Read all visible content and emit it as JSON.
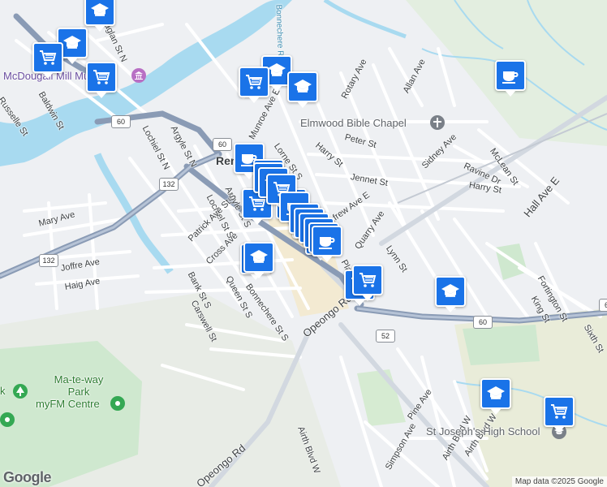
{
  "map": {
    "town_label": "Ren",
    "streets": [
      "Raglan St N",
      "Baldwin St",
      "Russelle St",
      "Lochiel St N",
      "Argyle St N",
      "Lochiel St S",
      "Argyle St S",
      "Patrick Ave St S",
      "Cross Ave",
      "Queen St S",
      "Bank St S",
      "Carswell St",
      "Mary Ave",
      "Joffre Ave",
      "Haig Ave",
      "Munroe Ave E",
      "Lorne St S",
      "Harry St",
      "Peter St",
      "Jennet St",
      "Harry St",
      "Rotary Ave",
      "Allan Ave",
      "Sidney Ave",
      "Ravine Dr",
      "McLean St",
      "Hall Ave E",
      "Quarry Ave",
      "Lynn St",
      "Fortington St",
      "King St",
      "Sixth St",
      "Opeongo Rd",
      "Renfrew Ave E",
      "Airth Blvd W",
      "Airth Blvd W",
      "Pine Ave",
      "Simpson Ave",
      "Opeongo Rd",
      "Airth Blvd W",
      "Plaunt St S",
      "Bonnechere St S",
      "Bonnechere River"
    ],
    "route_shields": [
      "60",
      "60",
      "132",
      "132",
      "60",
      "52",
      "60"
    ],
    "pois": {
      "museum": "McDougall Mill Museum",
      "chapel": "Elmwood Bible Chapel",
      "park": "Ma-te-way Park",
      "centre": "myFM Centre",
      "school": "St Joseph's High School",
      "park_edge": "k"
    },
    "markers": [
      "school-marker",
      "school-marker",
      "grocery-marker",
      "grocery-marker",
      "school-marker",
      "grocery-marker",
      "school-marker",
      "cafe-marker",
      "cafe-marker",
      "grocery-marker",
      "school-marker",
      "cafe-marker",
      "school-marker",
      "grocery-marker",
      "school-marker",
      "school-marker",
      "grocery-marker",
      "school-marker",
      "school-marker"
    ]
  },
  "footer": {
    "logo": "Google",
    "attribution": "Map data ©2025 Google"
  },
  "colors": {
    "road_major": "#8a9bb5",
    "water": "#a8daf0",
    "park": "#c8e6c9",
    "marker": "#1a73e8"
  }
}
